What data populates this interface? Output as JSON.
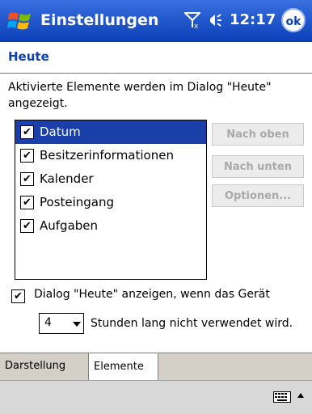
{
  "titlebar": {
    "title": "Einstellungen",
    "time": "12:17",
    "ok_label": "ok"
  },
  "page": {
    "title": "Heute",
    "description": "Aktivierte Elemente werden im Dialog \"Heute\" angezeigt."
  },
  "items": [
    {
      "label": "Datum",
      "checked": true,
      "selected": true
    },
    {
      "label": "Besitzerinformationen",
      "checked": true,
      "selected": false
    },
    {
      "label": "Kalender",
      "checked": true,
      "selected": false
    },
    {
      "label": "Posteingang",
      "checked": true,
      "selected": false
    },
    {
      "label": "Aufgaben",
      "checked": true,
      "selected": false
    }
  ],
  "buttons": {
    "up": "Nach oben",
    "down": "Nach unten",
    "options": "Optionen..."
  },
  "show_today": {
    "label": "Dialog \"Heute\" anzeigen, wenn das Gerät",
    "checked": true
  },
  "hours": {
    "value": "4",
    "suffix": "Stunden lang nicht verwendet wird."
  },
  "tabs": [
    {
      "label": "Darstellung",
      "active": false
    },
    {
      "label": "Elemente",
      "active": true
    }
  ],
  "colors": {
    "titlebar": "#0a3fb8",
    "selection": "#1a3fa8",
    "page_title": "#1040b0"
  }
}
